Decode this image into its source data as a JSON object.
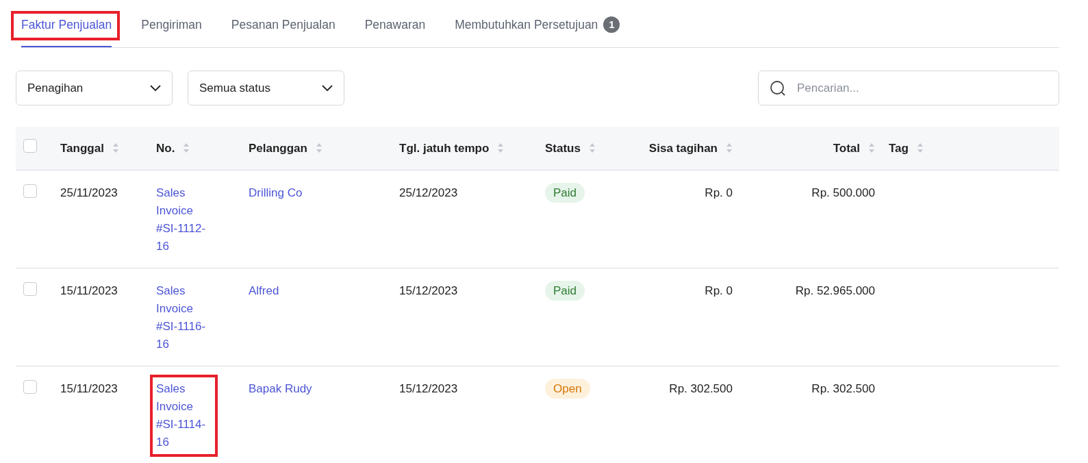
{
  "tabs": [
    {
      "label": "Faktur Penjualan",
      "selected": true,
      "highlighted": true
    },
    {
      "label": "Pengiriman",
      "selected": false,
      "highlighted": false
    },
    {
      "label": "Pesanan Penjualan",
      "selected": false,
      "highlighted": false
    },
    {
      "label": "Penawaran",
      "selected": false,
      "highlighted": false
    },
    {
      "label": "Membutuhkan Persetujuan",
      "selected": false,
      "highlighted": false,
      "badge": "1"
    }
  ],
  "filters": [
    {
      "value": "Penagihan"
    },
    {
      "value": "Semua status"
    }
  ],
  "search": {
    "placeholder": "Pencarian..."
  },
  "table": {
    "all_checked": false,
    "columns": [
      {
        "label": "Tanggal",
        "right_aligned": false
      },
      {
        "label": "No.",
        "right_aligned": false
      },
      {
        "label": "Pelanggan",
        "right_aligned": false
      },
      {
        "label": "Tgl. jatuh tempo",
        "right_aligned": false
      },
      {
        "label": "Status",
        "right_aligned": false
      },
      {
        "label": "Sisa tagihan",
        "right_aligned": true
      },
      {
        "label": "Total",
        "right_aligned": true
      },
      {
        "label": "Tag",
        "right_aligned": false
      }
    ],
    "rows": [
      {
        "checked": false,
        "date": "25/11/2023",
        "number": "Sales Invoice #SI-1112-16",
        "number_highlighted": false,
        "customer": "Drilling Co",
        "due": "25/12/2023",
        "status": {
          "label": "Paid",
          "kind": "paid"
        },
        "remaining": "Rp. 0",
        "total": "Rp. 500.000"
      },
      {
        "checked": false,
        "date": "15/11/2023",
        "number": "Sales Invoice #SI-1116-16",
        "number_highlighted": false,
        "customer": "Alfred",
        "due": "15/12/2023",
        "status": {
          "label": "Paid",
          "kind": "paid"
        },
        "remaining": "Rp. 0",
        "total": "Rp. 52.965.000"
      },
      {
        "checked": false,
        "date": "15/11/2023",
        "number": "Sales Invoice #SI-1114-16",
        "number_highlighted": true,
        "customer": "Bapak Rudy",
        "due": "15/12/2023",
        "status": {
          "label": "Open",
          "kind": "open"
        },
        "remaining": "Rp. 302.500",
        "total": "Rp. 302.500"
      }
    ]
  }
}
